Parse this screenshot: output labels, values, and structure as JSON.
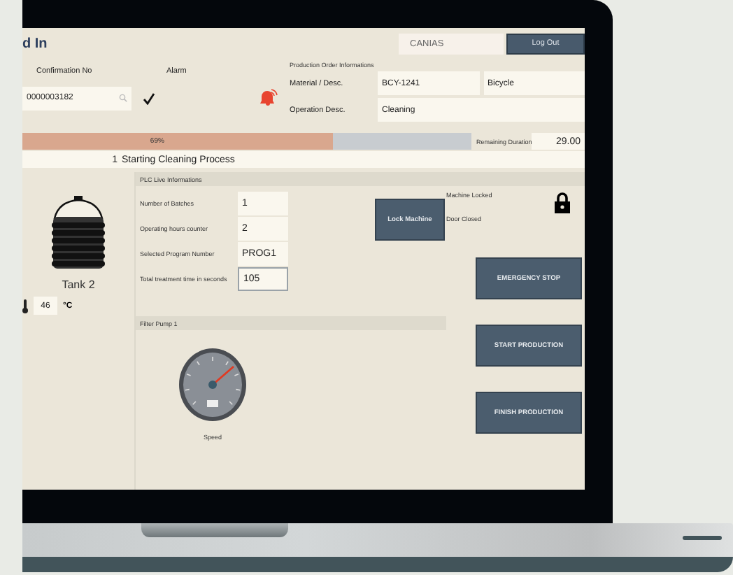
{
  "header": {
    "title": "d In",
    "system_field": "CANIAS",
    "logout": "Log Out"
  },
  "confirmation": {
    "label": "Confirmation No",
    "value": "0000003182",
    "confirmed": true
  },
  "alarm": {
    "label": "Alarm",
    "active": true
  },
  "production_order": {
    "title": "Production Order Informations",
    "rows": [
      {
        "label": "Material / Desc.",
        "values": [
          "BCY-1241",
          "Bicycle"
        ]
      },
      {
        "label": "Operation Desc.",
        "values": [
          "Cleaning"
        ]
      }
    ]
  },
  "progress": {
    "level": 0.69,
    "reading": "69%",
    "remaining_label": "Remaining Duration",
    "remaining_value": "29.00"
  },
  "step": {
    "number": "1",
    "text": "Starting Cleaning Process"
  },
  "tank": {
    "name": "Tank 2",
    "temperature": "46",
    "unit": "°C"
  },
  "plc": {
    "title": "PLC Live Informations",
    "rows": [
      {
        "label": "Number of Batches",
        "value": "1",
        "focused": false
      },
      {
        "label": "Operating hours counter",
        "value": "2",
        "focused": false
      },
      {
        "label": "Selected Program Number",
        "value": "PROG1",
        "focused": false
      },
      {
        "label": "Total treatment time in seconds",
        "value": "105",
        "focused": true
      }
    ]
  },
  "lock": {
    "button": "Lock Machine",
    "statuses": [
      "Machine Locked",
      "Door Closed"
    ],
    "locked": true
  },
  "pump": {
    "title": "Filter Pump 1",
    "gauge_label": "Speed"
  },
  "actions": [
    "EMERGENCY STOP",
    "START PRODUCTION",
    "FINISH PRODUCTION"
  ]
}
